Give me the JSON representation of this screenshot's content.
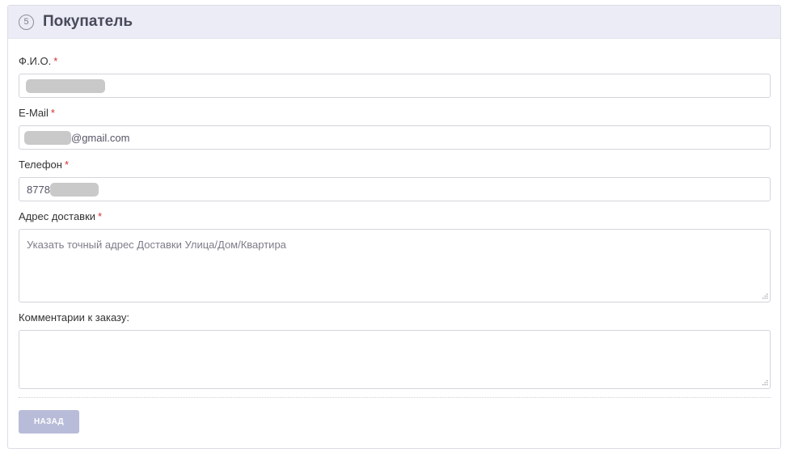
{
  "section": {
    "step_number": "5",
    "title": "Покупатель"
  },
  "fields": {
    "fio": {
      "label": "Ф.И.О.",
      "required_mark": "*",
      "value": ""
    },
    "email": {
      "label": "E-Mail",
      "required_mark": "*",
      "value_suffix": "@gmail.com"
    },
    "phone": {
      "label": "Телефон",
      "required_mark": "*",
      "value_prefix": "8778"
    },
    "address": {
      "label": "Адрес доставки",
      "required_mark": "*",
      "placeholder": "Указать точный адрес Доставки Улица/Дом/Квартира"
    },
    "comment": {
      "label": "Комментарии к заказу:",
      "value": ""
    }
  },
  "actions": {
    "back_label": "НАЗАД"
  },
  "colors": {
    "header_bg": "#ececf6",
    "required": "#d3302f",
    "button_bg": "#b8bcd8",
    "redaction": "#c9c9c9"
  }
}
